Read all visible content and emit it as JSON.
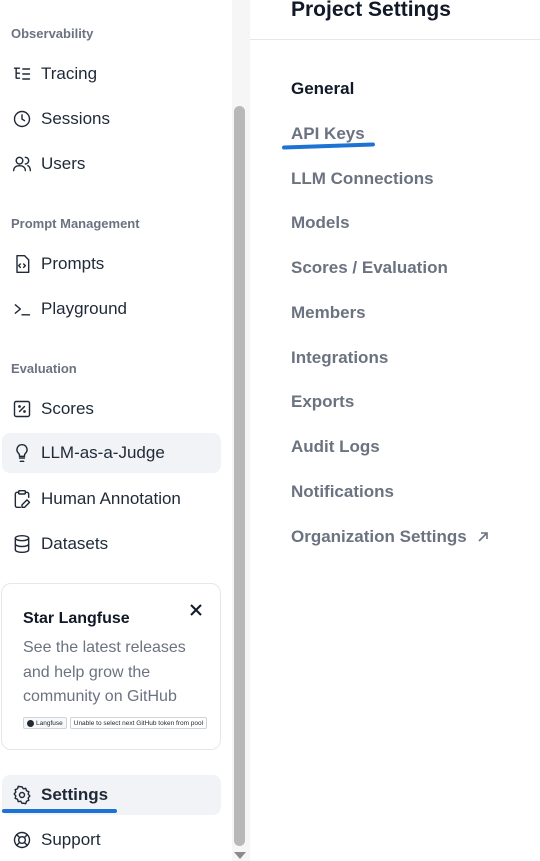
{
  "sidebar": {
    "sections": [
      {
        "title": "Observability",
        "items": [
          {
            "label": "Tracing",
            "icon": "tracing-icon"
          },
          {
            "label": "Sessions",
            "icon": "clock-icon"
          },
          {
            "label": "Users",
            "icon": "users-icon"
          }
        ]
      },
      {
        "title": "Prompt Management",
        "items": [
          {
            "label": "Prompts",
            "icon": "file-code-icon"
          },
          {
            "label": "Playground",
            "icon": "terminal-icon"
          }
        ]
      },
      {
        "title": "Evaluation",
        "items": [
          {
            "label": "Scores",
            "icon": "percent-square-icon"
          },
          {
            "label": "LLM-as-a-Judge",
            "icon": "lightbulb-icon"
          },
          {
            "label": "Human Annotation",
            "icon": "clipboard-pen-icon"
          },
          {
            "label": "Datasets",
            "icon": "database-icon"
          }
        ]
      }
    ],
    "footer": [
      {
        "label": "Settings",
        "icon": "gear-icon"
      },
      {
        "label": "Support",
        "icon": "lifebuoy-icon"
      }
    ]
  },
  "star_card": {
    "title": "Star Langfuse",
    "description": "See the latest releases and help grow the community on GitHub",
    "badge_repo": "Langfuse",
    "badge_status": "Unable to select next GitHub token from pool"
  },
  "main": {
    "title": "Project Settings",
    "nav": [
      "General",
      "API Keys",
      "LLM Connections",
      "Models",
      "Scores / Evaluation",
      "Members",
      "Integrations",
      "Exports",
      "Audit Logs",
      "Notifications",
      "Organization Settings"
    ]
  },
  "colors": {
    "accent_mark": "#1d73d3",
    "active_bg": "#f1f3f6",
    "muted_text": "#6b7280"
  }
}
